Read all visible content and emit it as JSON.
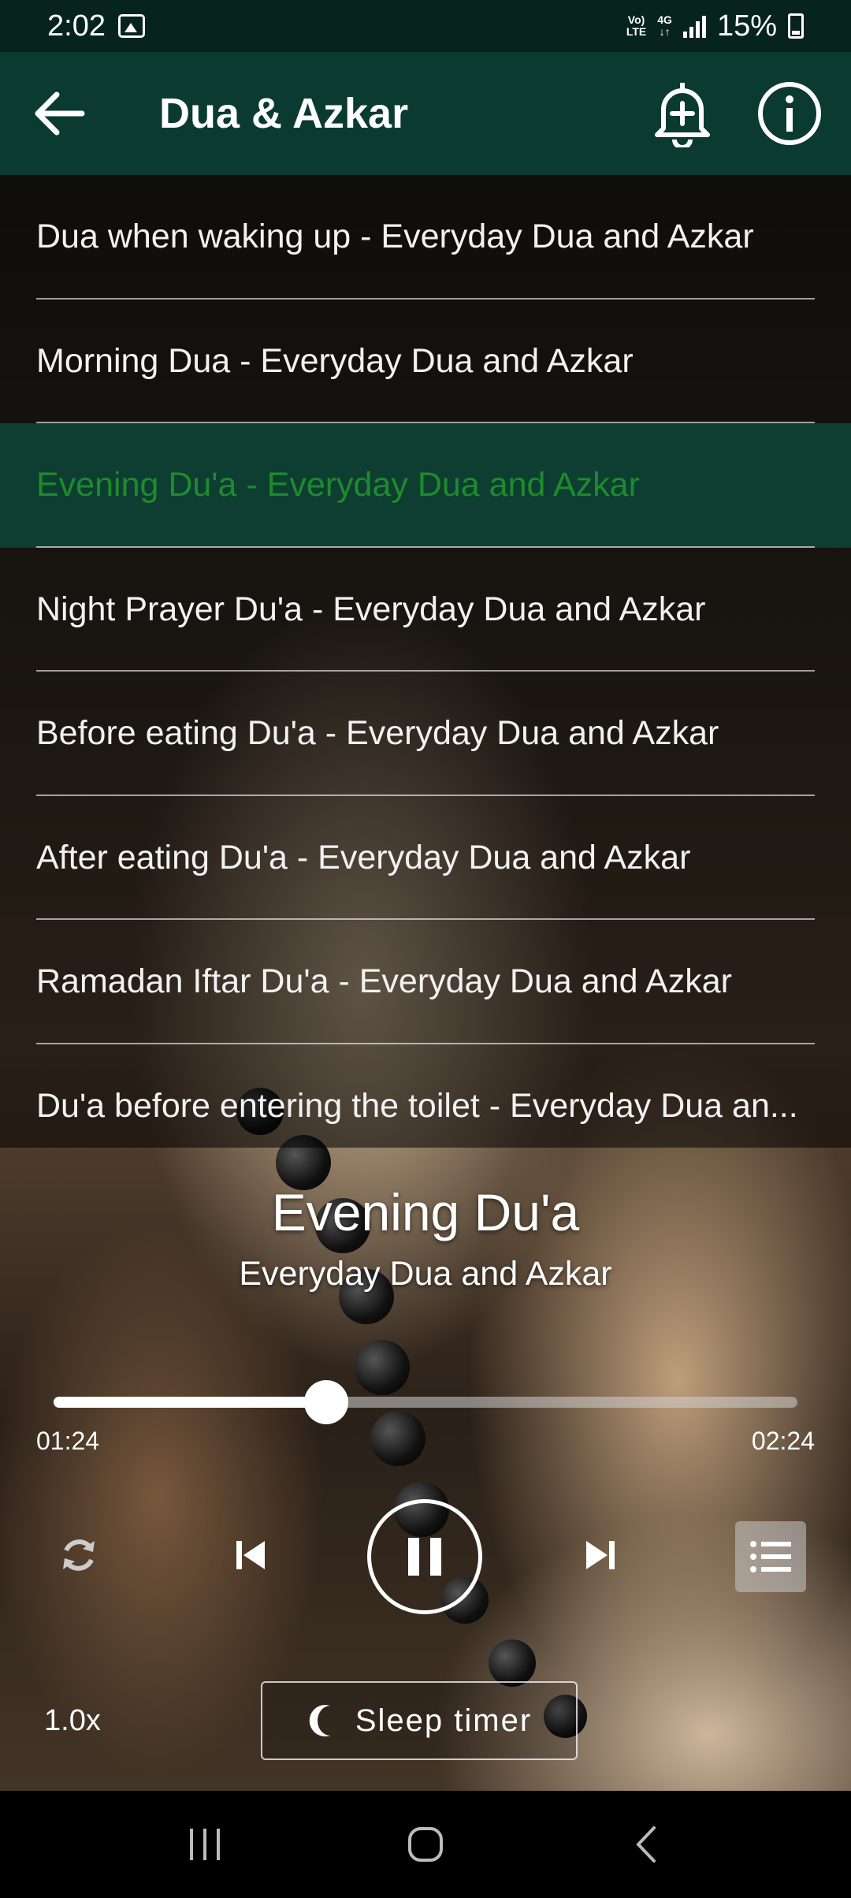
{
  "status_bar": {
    "time": "2:02",
    "network_top": "Vo)",
    "network_bottom": "LTE",
    "data_top": "4G",
    "battery": "15%"
  },
  "app_bar": {
    "title": "Dua & Azkar"
  },
  "playlist": [
    {
      "label": "Dua when waking up - Everyday Dua and Azkar",
      "active": false
    },
    {
      "label": "Morning Dua - Everyday Dua and Azkar",
      "active": false
    },
    {
      "label": "Evening Du'a - Everyday Dua and Azkar",
      "active": true
    },
    {
      "label": "Night Prayer Du'a - Everyday Dua and Azkar",
      "active": false
    },
    {
      "label": "Before eating Du'a - Everyday Dua and Azkar",
      "active": false
    },
    {
      "label": "After eating Du'a - Everyday Dua and Azkar",
      "active": false
    },
    {
      "label": "Ramadan Iftar Du'a - Everyday Dua and Azkar",
      "active": false
    },
    {
      "label": "Du'a before entering the toilet - Everyday Dua an...",
      "active": false
    }
  ],
  "now_playing": {
    "title": "Evening Du'a",
    "artist": "Everyday Dua and Azkar"
  },
  "progress": {
    "elapsed": "01:24",
    "total": "02:24",
    "fraction": 0.366
  },
  "controls": {
    "speed": "1.0x",
    "sleep_timer": "Sleep timer"
  },
  "colors": {
    "app_bar": "#0b3b30",
    "status_bar": "#06231c",
    "active_item_text": "#1f8a2e",
    "active_item_bg": "#0c4637"
  },
  "icons": [
    "back-arrow-icon",
    "alarm-add-icon",
    "info-icon",
    "repeat-icon",
    "skip-previous-icon",
    "pause-icon",
    "skip-next-icon",
    "playlist-icon",
    "moon-icon",
    "recents-icon",
    "home-icon",
    "nav-back-icon"
  ]
}
